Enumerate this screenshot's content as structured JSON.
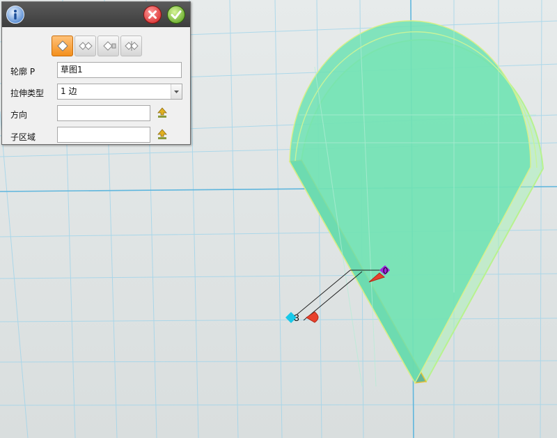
{
  "panel": {
    "mode_buttons": [
      {
        "name": "mode-one-side",
        "active": true
      },
      {
        "name": "mode-two-sides",
        "active": false
      },
      {
        "name": "mode-to-face",
        "active": false
      },
      {
        "name": "mode-symmetric",
        "active": false
      }
    ],
    "rows": {
      "profile": {
        "label": "轮廓 P",
        "value": "草图1"
      },
      "extrude_type": {
        "label": "拉伸类型",
        "value": "1 边"
      },
      "direction": {
        "label": "方向",
        "value": ""
      },
      "sub_region": {
        "label": "子区域",
        "value": ""
      }
    }
  },
  "icons": {
    "info": "info-icon",
    "close": "close-icon",
    "confirm": "checkmark-icon",
    "dropdown": "chevron-down-icon",
    "pick": "pick-arrow-icon"
  },
  "viewport": {
    "handle_labels": {
      "top": "0",
      "bottom": "3"
    }
  },
  "colors": {
    "header": "#3d3d3d",
    "active_mode": "#f38f1c",
    "shape_fill": "#6fe2b4",
    "shape_edge": "#f0c23a",
    "grid": "#8ed0ea",
    "grid_axis": "#5ab4dc",
    "handle_red": "#e8412c",
    "handle_cyan": "#18c8e8",
    "handle_purple": "#a020e0"
  }
}
